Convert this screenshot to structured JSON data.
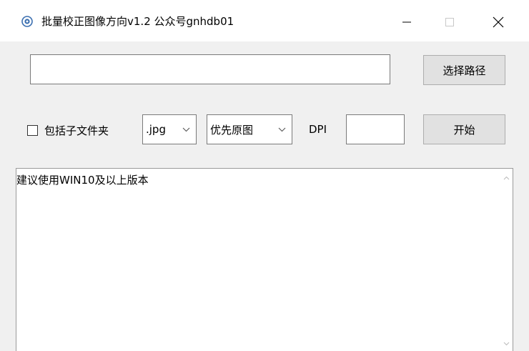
{
  "window": {
    "title": "批量校正图像方向v1.2  公众号gnhdb01",
    "icon": "app-icon"
  },
  "toolbar": {
    "path_value": "",
    "browse_label": "选择路径",
    "include_subfolders_label": "包括子文件夹",
    "include_subfolders_checked": false,
    "extension_selected": ".jpg",
    "mode_selected": "优先原图",
    "dpi_label": "DPI",
    "dpi_value": "",
    "start_label": "开始"
  },
  "log": {
    "text": "建议使用WIN10及以上版本"
  }
}
